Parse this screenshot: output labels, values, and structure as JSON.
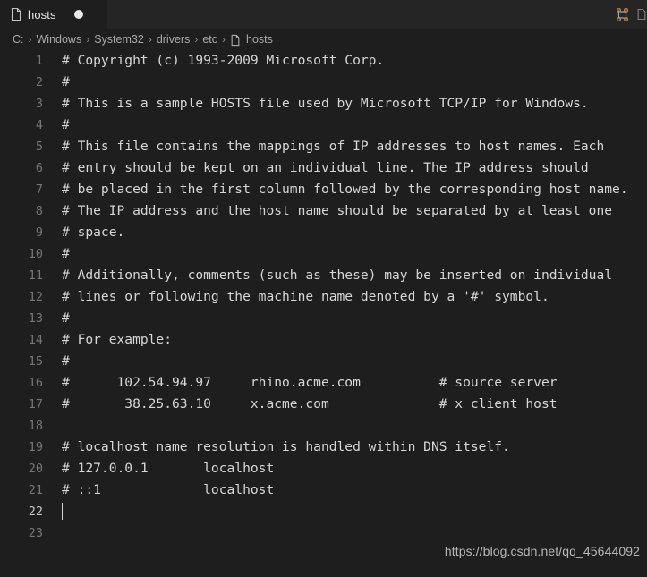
{
  "window": {
    "background_color": "#1e1e1e",
    "tabbar_background_color": "#252526"
  },
  "tabbar": {
    "tabs": [
      {
        "label": "hosts",
        "icon": "file-icon",
        "dirty": true,
        "active": true
      }
    ],
    "actions": [
      {
        "name": "split-editor-icon",
        "title": "Split Editor"
      },
      {
        "name": "more-actions-icon",
        "title": "More Actions"
      }
    ]
  },
  "breadcrumb": {
    "separator": "›",
    "items": [
      {
        "label": "C:",
        "icon": null
      },
      {
        "label": "Windows",
        "icon": null
      },
      {
        "label": "System32",
        "icon": null
      },
      {
        "label": "drivers",
        "icon": null
      },
      {
        "label": "etc",
        "icon": null
      },
      {
        "label": "hosts",
        "icon": "file-icon"
      }
    ]
  },
  "editor": {
    "language": "plaintext",
    "cursor_line": 22,
    "text_color": "#d6d6d6",
    "line_number_color": "#767676",
    "active_line_number_color": "#c6c6c6",
    "lines": [
      {
        "n": "1",
        "text": "# Copyright (c) 1993-2009 Microsoft Corp."
      },
      {
        "n": "2",
        "text": "#"
      },
      {
        "n": "3",
        "text": "# This is a sample HOSTS file used by Microsoft TCP/IP for Windows."
      },
      {
        "n": "4",
        "text": "#"
      },
      {
        "n": "5",
        "text": "# This file contains the mappings of IP addresses to host names. Each"
      },
      {
        "n": "6",
        "text": "# entry should be kept on an individual line. The IP address should"
      },
      {
        "n": "7",
        "text": "# be placed in the first column followed by the corresponding host name."
      },
      {
        "n": "8",
        "text": "# The IP address and the host name should be separated by at least one"
      },
      {
        "n": "9",
        "text": "# space."
      },
      {
        "n": "10",
        "text": "#"
      },
      {
        "n": "11",
        "text": "# Additionally, comments (such as these) may be inserted on individual"
      },
      {
        "n": "12",
        "text": "# lines or following the machine name denoted by a '#' symbol."
      },
      {
        "n": "13",
        "text": "#"
      },
      {
        "n": "14",
        "text": "# For example:"
      },
      {
        "n": "15",
        "text": "#"
      },
      {
        "n": "16",
        "text": "#      102.54.94.97     rhino.acme.com          # source server"
      },
      {
        "n": "17",
        "text": "#       38.25.63.10     x.acme.com              # x client host"
      },
      {
        "n": "18",
        "text": ""
      },
      {
        "n": "19",
        "text": "# localhost name resolution is handled within DNS itself."
      },
      {
        "n": "20",
        "text": "# 127.0.0.1       localhost"
      },
      {
        "n": "21",
        "text": "# ::1             localhost"
      },
      {
        "n": "22",
        "text": "",
        "current": true,
        "caret": true
      },
      {
        "n": "23",
        "text": ""
      }
    ]
  },
  "watermark": {
    "text": "https://blog.csdn.net/qq_45644092"
  }
}
